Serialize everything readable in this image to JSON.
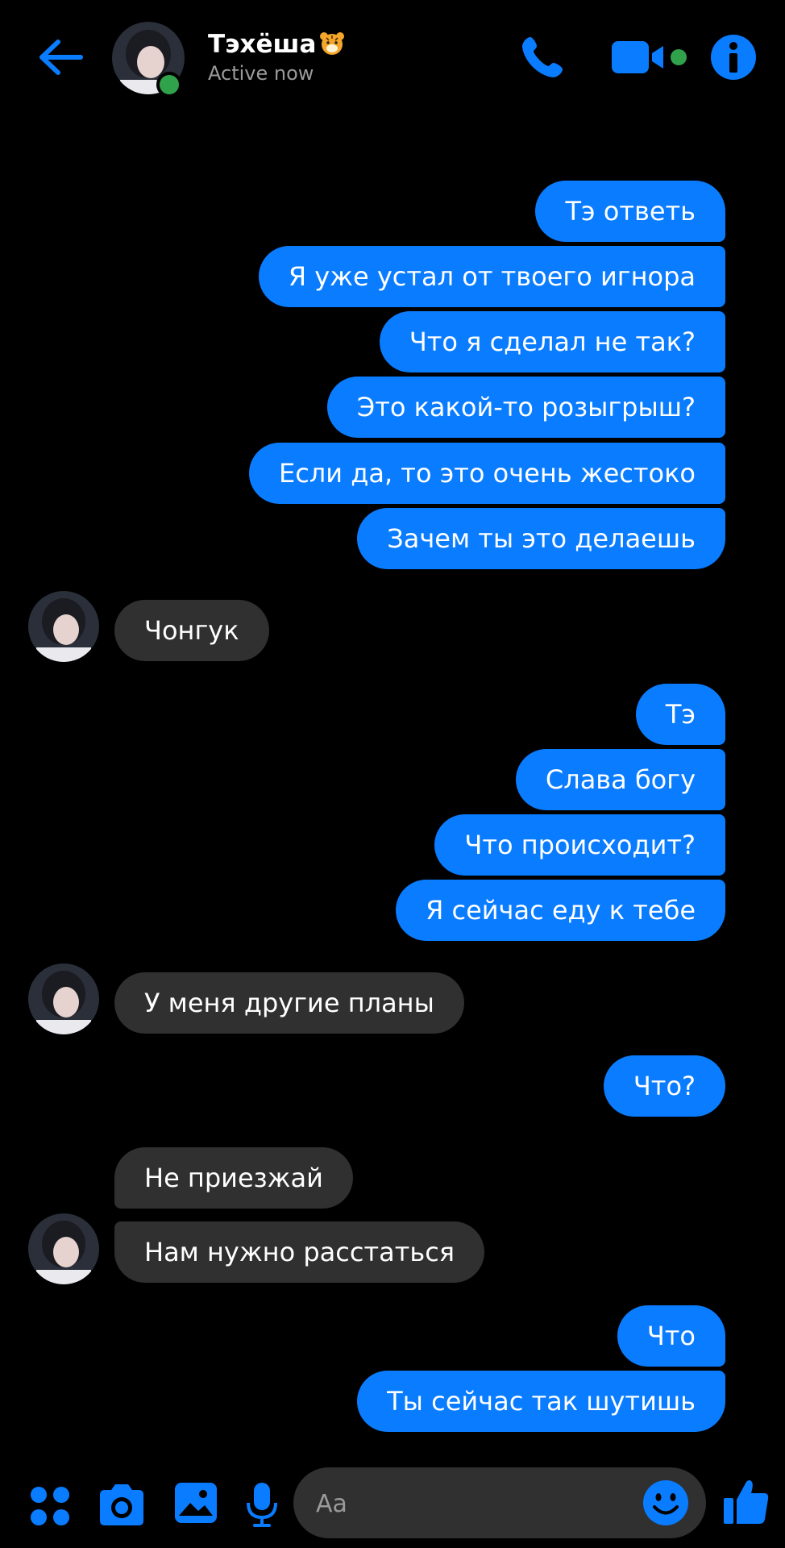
{
  "header": {
    "contact_name": "Тэхёша",
    "status": "Active now",
    "colors": {
      "accent": "#0a7cff",
      "online": "#31a24c",
      "call_indicator": "#31a24c"
    },
    "icons": [
      "back-arrow-icon",
      "phone-icon",
      "video-camera-icon",
      "info-icon"
    ]
  },
  "messages": [
    {
      "from": "me",
      "text": "Тэ ответь"
    },
    {
      "from": "me",
      "text": "Я уже устал от твоего игнора"
    },
    {
      "from": "me",
      "text": "Что я сделал не так?"
    },
    {
      "from": "me",
      "text": "Это какой-то розыгрыш?"
    },
    {
      "from": "me",
      "text": "Если да, то это очень жестоко"
    },
    {
      "from": "me",
      "text": "Зачем ты это делаешь"
    },
    {
      "from": "them",
      "text": "Чонгук"
    },
    {
      "from": "me",
      "text": "Тэ"
    },
    {
      "from": "me",
      "text": "Слава богу"
    },
    {
      "from": "me",
      "text": "Что происходит?"
    },
    {
      "from": "me",
      "text": "Я сейчас еду к тебе"
    },
    {
      "from": "them",
      "text": "У меня другие планы"
    },
    {
      "from": "me",
      "text": "Что?"
    },
    {
      "from": "them",
      "text": "Не приезжай"
    },
    {
      "from": "them",
      "text": "Нам нужно расстаться"
    },
    {
      "from": "me",
      "text": "Что"
    },
    {
      "from": "me",
      "text": "Ты сейчас так шутишь"
    }
  ],
  "composer": {
    "placeholder": "Aa",
    "icons": [
      "apps-icon",
      "camera-icon",
      "gallery-icon",
      "microphone-icon",
      "emoji-icon",
      "thumbs-up-icon"
    ]
  }
}
